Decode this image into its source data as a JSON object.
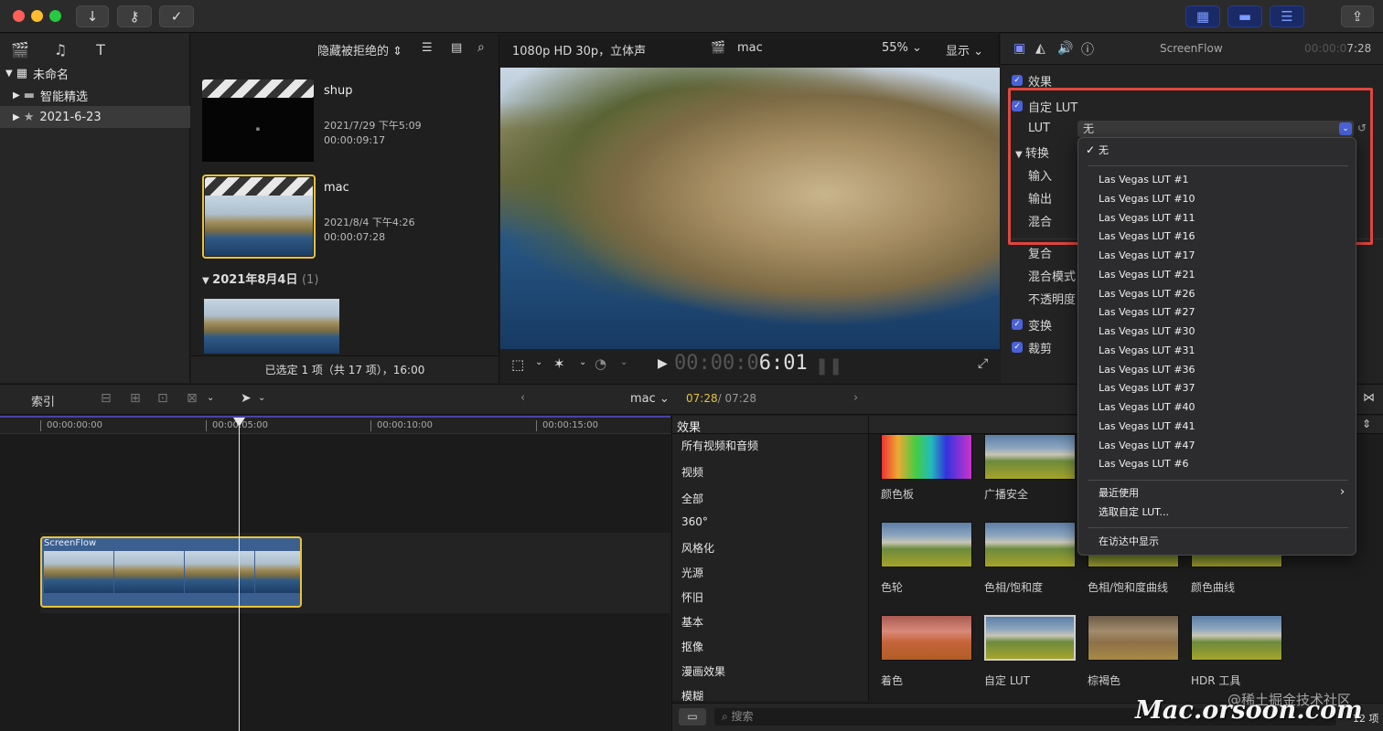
{
  "library": {
    "events": [
      {
        "label": "未命名",
        "icon": "library-icon"
      },
      {
        "label": "智能精选",
        "icon": "folder-icon"
      },
      {
        "label": "2021-6-23",
        "icon": "star-event-icon"
      }
    ]
  },
  "browser": {
    "filter_label": "隐藏被拒绝的",
    "clips": [
      {
        "name": "shup",
        "date": "2021/7/29 下午5:09",
        "duration": "00:00:09:17"
      },
      {
        "name": "mac",
        "date": "2021/8/4 下午4:26",
        "duration": "00:00:07:28"
      }
    ],
    "group_header": "2021年8月4日",
    "group_count": "(1)",
    "status": "已选定 1 项（共 17 项），16:00"
  },
  "viewer": {
    "format": "1080p HD 30p，立体声",
    "clip_name": "mac",
    "zoom": "55%",
    "display_label": "显示",
    "timecode_dim": "00:00:0",
    "timecode_bright": "6:01"
  },
  "inspector": {
    "clip_title": "ScreenFlow",
    "time_dim": "00:00:0",
    "time_bright": "7:28",
    "effects_label": "效果",
    "custom_lut_label": "自定 LUT",
    "lut_label": "LUT",
    "lut_value": "无",
    "convert_label": "转换",
    "input_label": "输入",
    "output_label": "输出",
    "mix_label": "混合",
    "composite_label": "复合",
    "blend_mode_label": "混合模式",
    "opacity_label": "不透明度",
    "transform_label": "变换",
    "crop_label": "裁剪"
  },
  "dropdown": {
    "selected": "无",
    "items": [
      "Las Vegas LUT #1",
      "Las Vegas LUT #10",
      "Las Vegas LUT #11",
      "Las Vegas LUT #16",
      "Las Vegas LUT #17",
      "Las Vegas LUT #21",
      "Las Vegas LUT #26",
      "Las Vegas LUT #27",
      "Las Vegas LUT #30",
      "Las Vegas LUT #31",
      "Las Vegas LUT #36",
      "Las Vegas LUT #37",
      "Las Vegas LUT #40",
      "Las Vegas LUT #41",
      "Las Vegas LUT #47",
      "Las Vegas LUT #6"
    ],
    "recent": "最近使用",
    "choose_custom": "选取自定 LUT...",
    "show_in_finder": "在访达中显示"
  },
  "timeline": {
    "index_label": "索引",
    "project_name": "mac",
    "time_current": "07:28",
    "time_total": "/ 07:28",
    "ticks": [
      "00:00:00:00",
      "00:00:05:00",
      "00:00:10:00",
      "00:00:15:00"
    ],
    "clip_name": "ScreenFlow"
  },
  "effects": {
    "header": "效果",
    "categories": [
      "所有视频和音频",
      "视频",
      "全部",
      "360°",
      "风格化",
      "光源",
      "怀旧",
      "基本",
      "抠像",
      "漫画效果",
      "模糊"
    ],
    "tiles": [
      {
        "label": "颜色板"
      },
      {
        "label": "广播安全"
      },
      {
        "label": "色轮"
      },
      {
        "label": "色相/饱和度"
      },
      {
        "label": "色相/饱和度曲线"
      },
      {
        "label": "颜色曲线"
      },
      {
        "label": "着色"
      },
      {
        "label": "自定 LUT"
      },
      {
        "label": "棕褐色"
      },
      {
        "label": "HDR 工具"
      }
    ],
    "search_placeholder": "搜索",
    "count": "12 项"
  },
  "watermark": {
    "site": "Mac.orsoon.com",
    "community": "@稀土掘金技术社区"
  }
}
